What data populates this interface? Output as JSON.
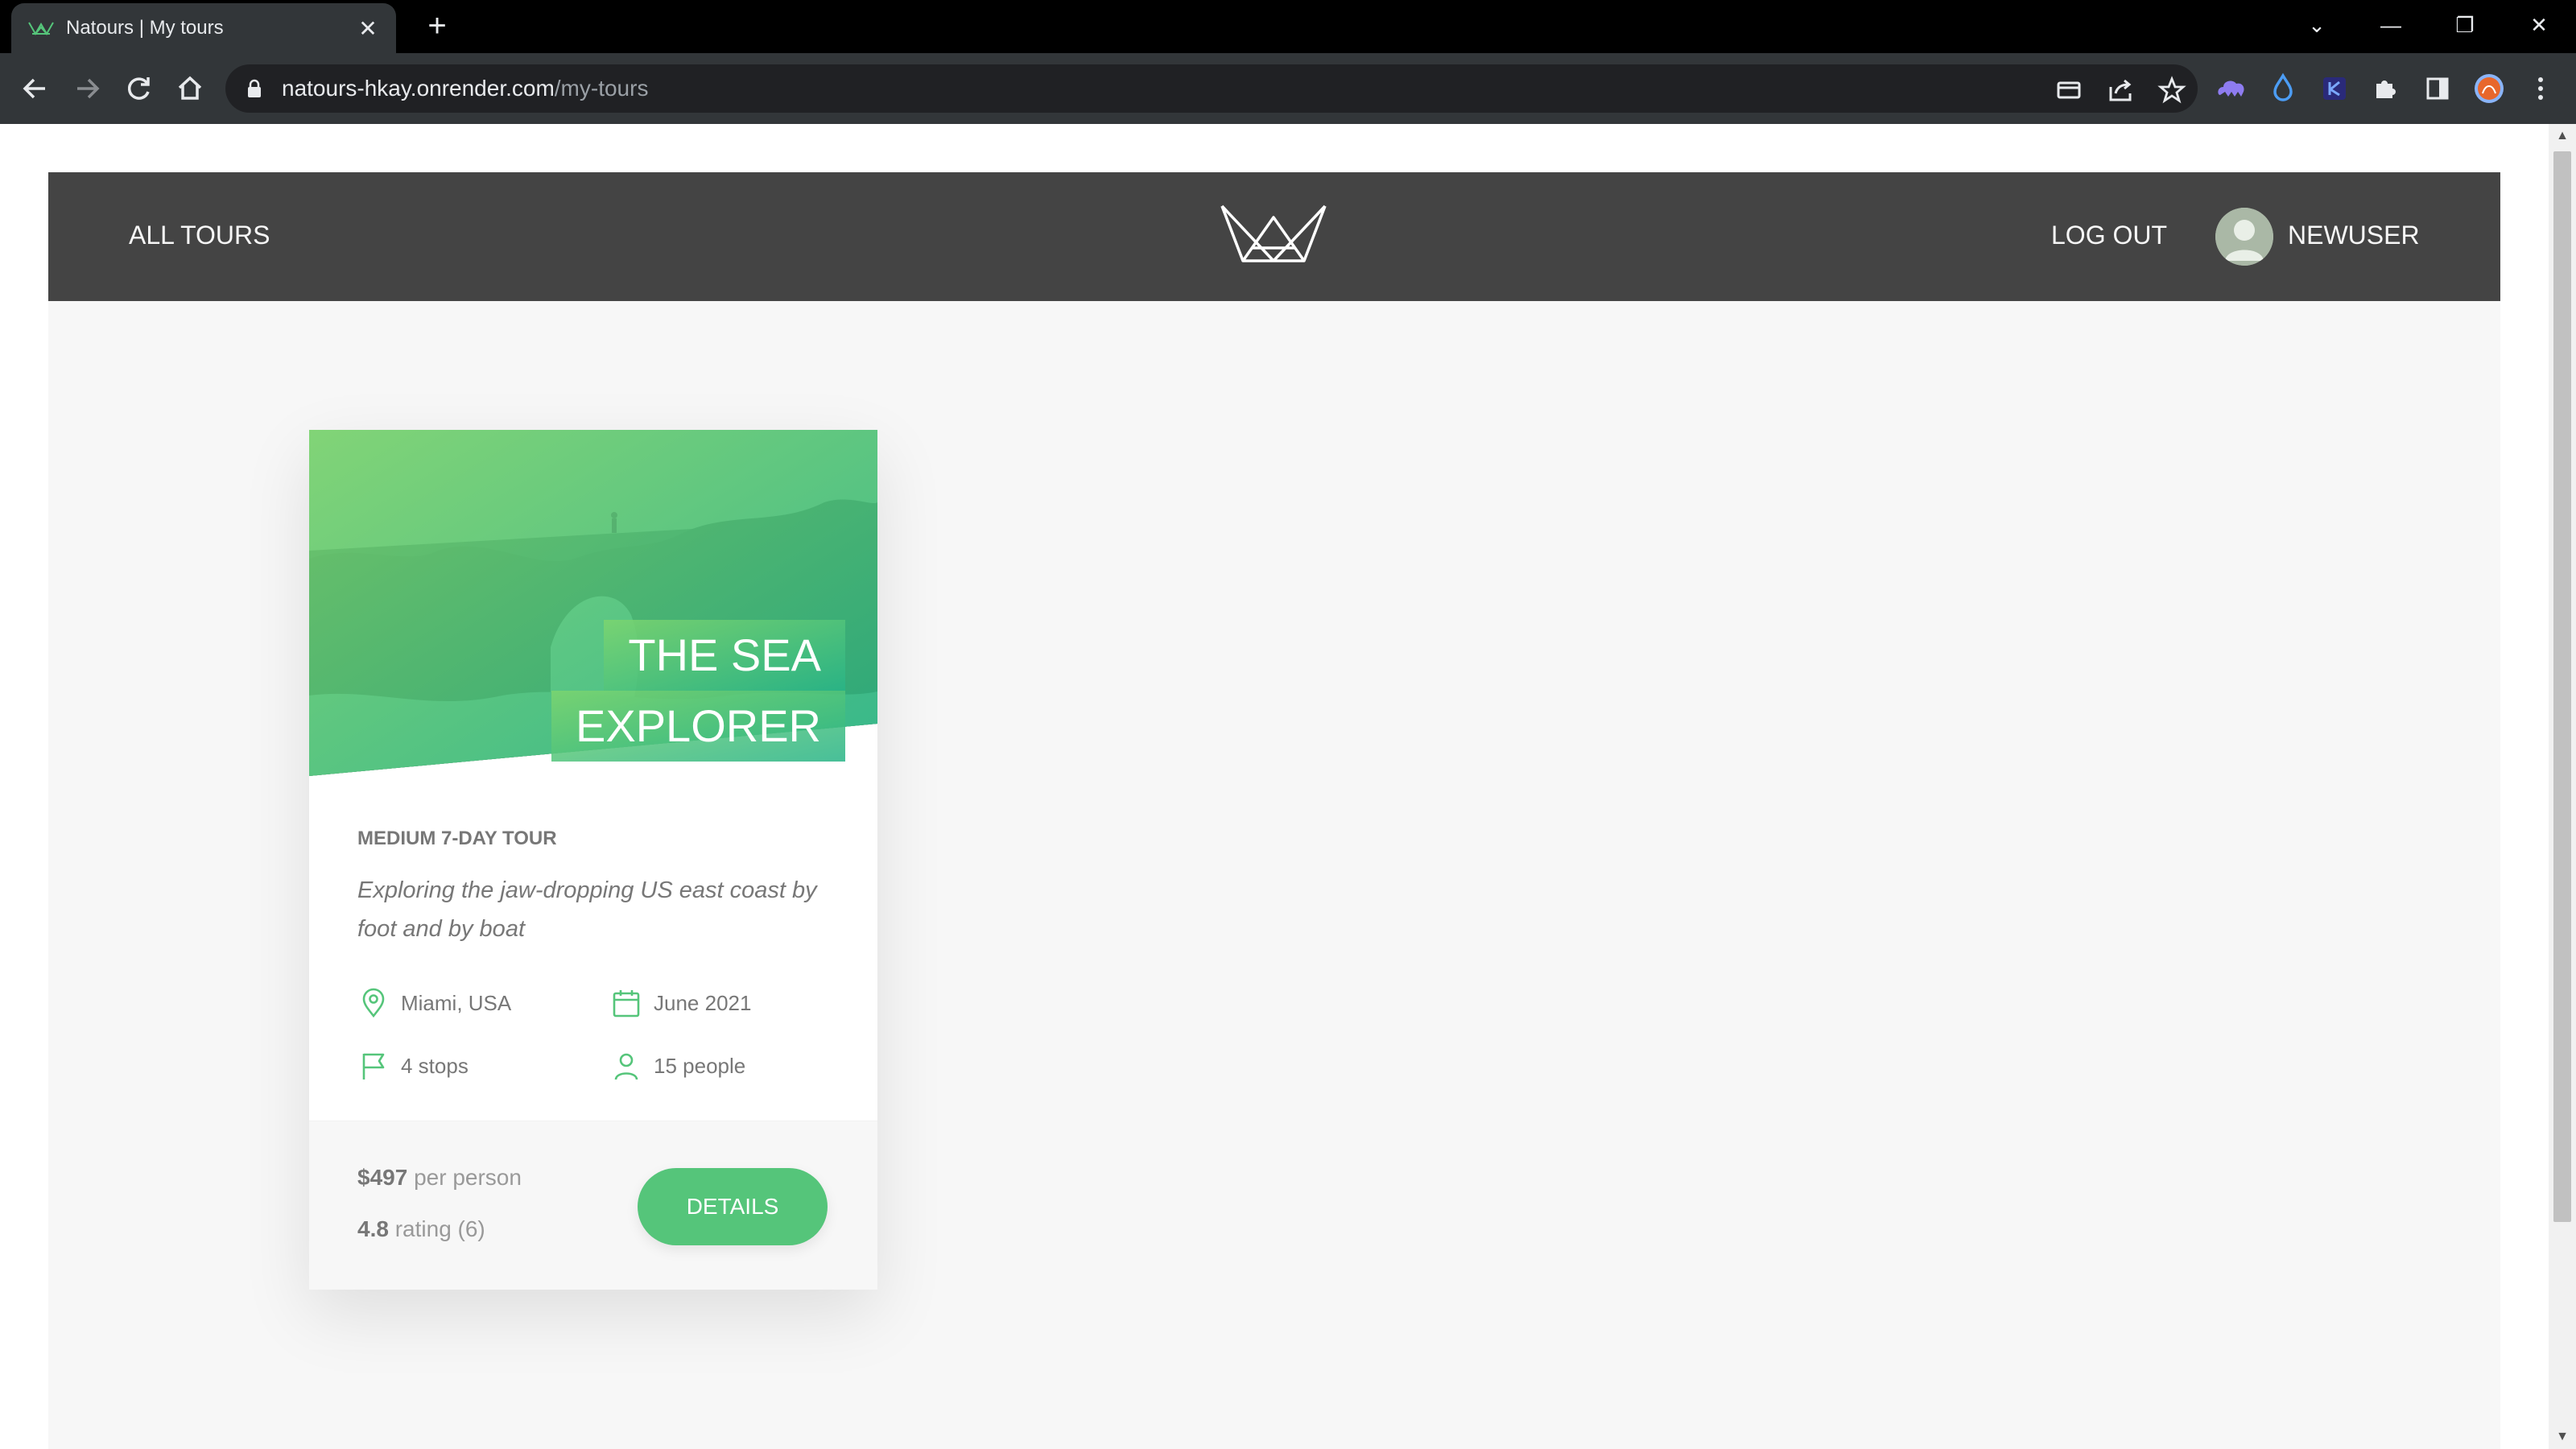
{
  "browser": {
    "tab_title": "Natours | My tours",
    "tab_close": "✕",
    "new_tab": "+",
    "url_host": "natours-hkay.onrender.com",
    "url_path": "/my-tours",
    "window_controls": {
      "minimize": "—",
      "restore": "❐",
      "close": "✕",
      "tab_search": "⌄"
    }
  },
  "site": {
    "nav_all_tours": "ALL TOURS",
    "nav_logout": "LOG OUT",
    "user_name": "NEWUSER"
  },
  "tour_card": {
    "title_line1": "THE SEA",
    "title_line2": "EXPLORER",
    "subheading": "MEDIUM 7-DAY TOUR",
    "summary": "Exploring the jaw-dropping US east coast by foot and by boat",
    "location": "Miami, USA",
    "date": "June 2021",
    "stops": "4 stops",
    "people": "15 people",
    "price_value": "$497",
    "price_label": "per person",
    "rating_value": "4.8",
    "rating_label": "rating (6)",
    "details_button": "DETAILS"
  },
  "colors": {
    "accent_green": "#55c57a",
    "header_dark": "#444444",
    "page_bg": "#f7f7f7"
  }
}
